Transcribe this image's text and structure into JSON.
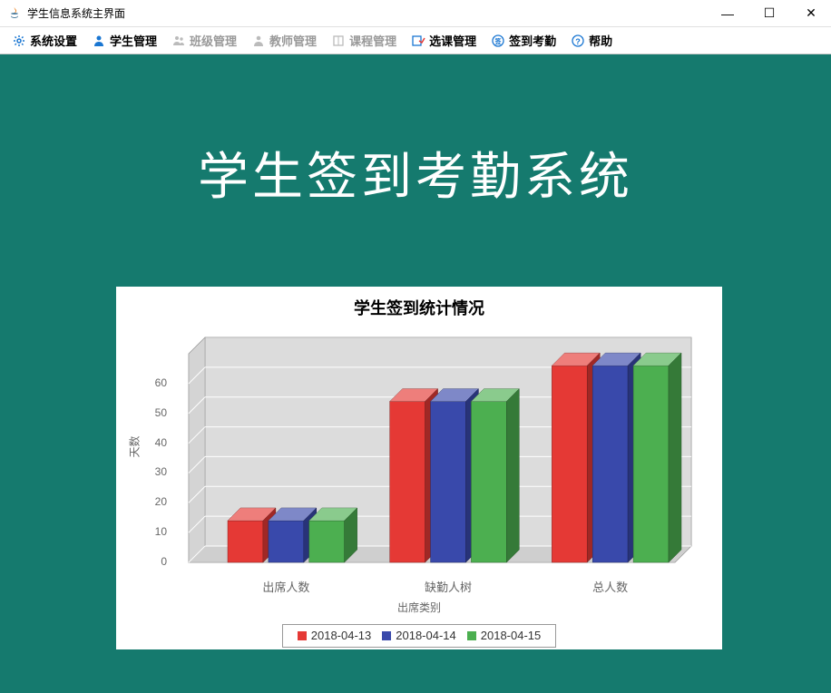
{
  "window": {
    "title": "学生信息系统主界面"
  },
  "menu": {
    "items": [
      {
        "label": "系统设置",
        "active": true,
        "icon": "gear"
      },
      {
        "label": "学生管理",
        "active": true,
        "icon": "student"
      },
      {
        "label": "班级管理",
        "active": false,
        "icon": "people"
      },
      {
        "label": "教师管理",
        "active": false,
        "icon": "teacher"
      },
      {
        "label": "课程管理",
        "active": false,
        "icon": "book"
      },
      {
        "label": "选课管理",
        "active": true,
        "icon": "select",
        "blue": true
      },
      {
        "label": "签到考勤",
        "active": true,
        "icon": "check",
        "blue": true
      },
      {
        "label": "帮助",
        "active": true,
        "icon": "help",
        "blue": true
      }
    ]
  },
  "main": {
    "title": "学生签到考勤系统"
  },
  "chart_data": {
    "type": "bar",
    "title": "学生签到统计情况",
    "xlabel": "出席类别",
    "ylabel": "天数",
    "ylim": [
      0,
      70
    ],
    "yticks": [
      0,
      10,
      20,
      30,
      40,
      50,
      60
    ],
    "categories": [
      "出席人数",
      "缺勤人树",
      "总人数"
    ],
    "series": [
      {
        "name": "2018-04-13",
        "color": "#e53935",
        "values": [
          14,
          54,
          66
        ]
      },
      {
        "name": "2018-04-14",
        "color": "#3949ab",
        "values": [
          14,
          54,
          66
        ]
      },
      {
        "name": "2018-04-15",
        "color": "#4caf50",
        "values": [
          14,
          54,
          66
        ]
      }
    ]
  }
}
